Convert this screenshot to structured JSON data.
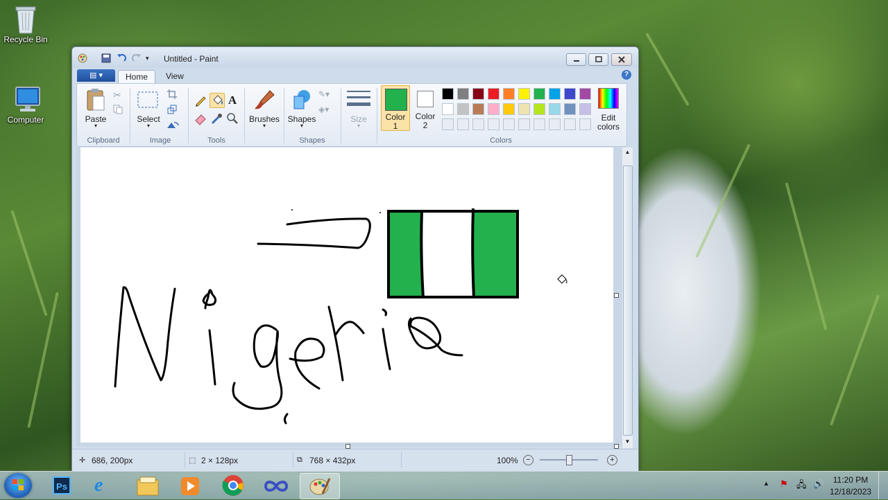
{
  "desktop": {
    "icons": [
      {
        "label": "Recycle Bin"
      },
      {
        "label": "Computer"
      }
    ]
  },
  "window": {
    "title": "Untitled - Paint",
    "min_label": "▭",
    "max_label": "▭",
    "close_label": "✕"
  },
  "tabs": {
    "file_label": "▤ ▾",
    "home": "Home",
    "view": "View",
    "help": "?"
  },
  "ribbon": {
    "clipboard": {
      "paste": "Paste",
      "group": "Clipboard"
    },
    "image": {
      "select": "Select",
      "group": "Image"
    },
    "tools": {
      "group": "Tools"
    },
    "brushes": {
      "label": "Brushes"
    },
    "shapes": {
      "label": "Shapes",
      "group": "Shapes"
    },
    "size": {
      "label": "Size"
    },
    "color1": {
      "label1": "Color",
      "label2": "1",
      "value": "#22b14c"
    },
    "color2": {
      "label1": "Color",
      "label2": "2",
      "value": "#ffffff"
    },
    "colors_group": "Colors",
    "edit_colors": {
      "label1": "Edit",
      "label2": "colors"
    },
    "palette_row1": [
      "#000000",
      "#7f7f7f",
      "#880015",
      "#ed1c24",
      "#ff7f27",
      "#fff200",
      "#22b14c",
      "#00a2e8",
      "#3f48cc",
      "#a349a4"
    ],
    "palette_row2": [
      "#ffffff",
      "#c3c3c3",
      "#b97a57",
      "#ffaec9",
      "#ffc90e",
      "#efe4b0",
      "#b5e61d",
      "#99d9ea",
      "#7092be",
      "#c8bfe7"
    ]
  },
  "canvas": {
    "flag_left": "#22b14c",
    "flag_mid": "#ffffff",
    "flag_right": "#22b14c",
    "drawing_text": "Nigeria"
  },
  "status": {
    "cursor": "686, 200px",
    "selection": "2 × 128px",
    "image_size": "768 × 432px",
    "zoom": "100%"
  },
  "taskbar": {
    "apps": [
      "photoshop-icon",
      "ie-icon",
      "explorer-icon",
      "media-player-icon",
      "chrome-icon",
      "app-icon",
      "paint-icon"
    ],
    "time": "11:20 PM",
    "date": "12/18/2023"
  }
}
